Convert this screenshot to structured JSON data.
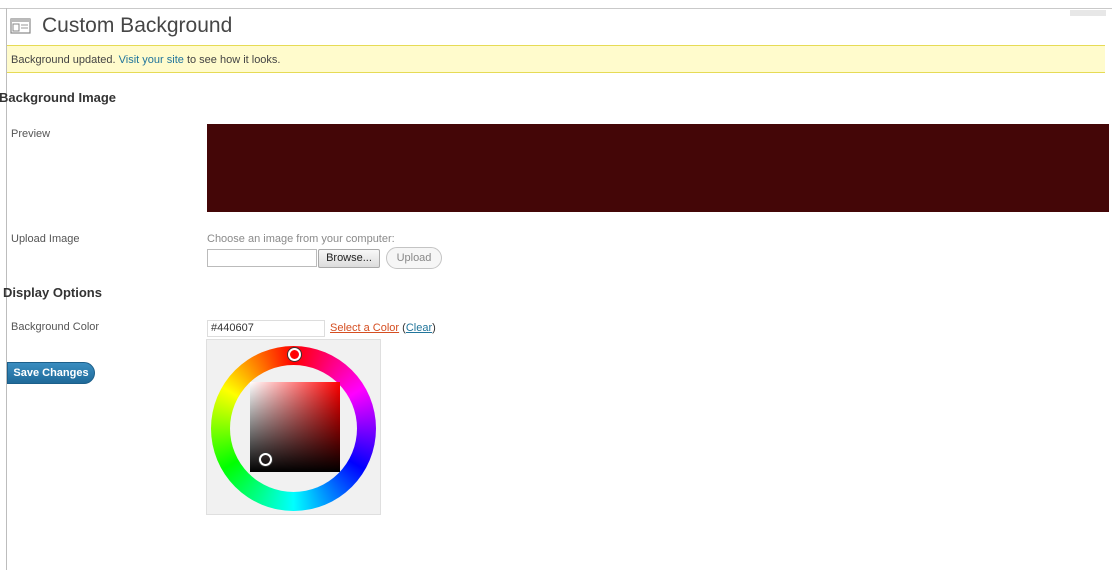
{
  "page": {
    "title": "Custom Background",
    "icon": "appearance-icon"
  },
  "notice": {
    "text_before": "Background updated.",
    "link_text": "Visit your site",
    "text_after": "to see how it looks."
  },
  "sections": {
    "background_image": "Background Image",
    "display_options": "Display Options"
  },
  "preview": {
    "label": "Preview",
    "color": "#440607"
  },
  "upload": {
    "label": "Upload Image",
    "description": "Choose an image from your computer:",
    "file_value": "",
    "browse_label": "Browse...",
    "upload_label": "Upload"
  },
  "background_color": {
    "label": "Background Color",
    "value": "#440607",
    "select_link": "Select a Color",
    "open_paren": "(",
    "clear_link": "Clear",
    "close_paren": ")"
  },
  "save": {
    "label": "Save Changes"
  },
  "colors": {
    "notice_bg": "#fffbcc",
    "link": "#21759b",
    "select_link": "#d54e21",
    "primary_button": "#21759b"
  }
}
